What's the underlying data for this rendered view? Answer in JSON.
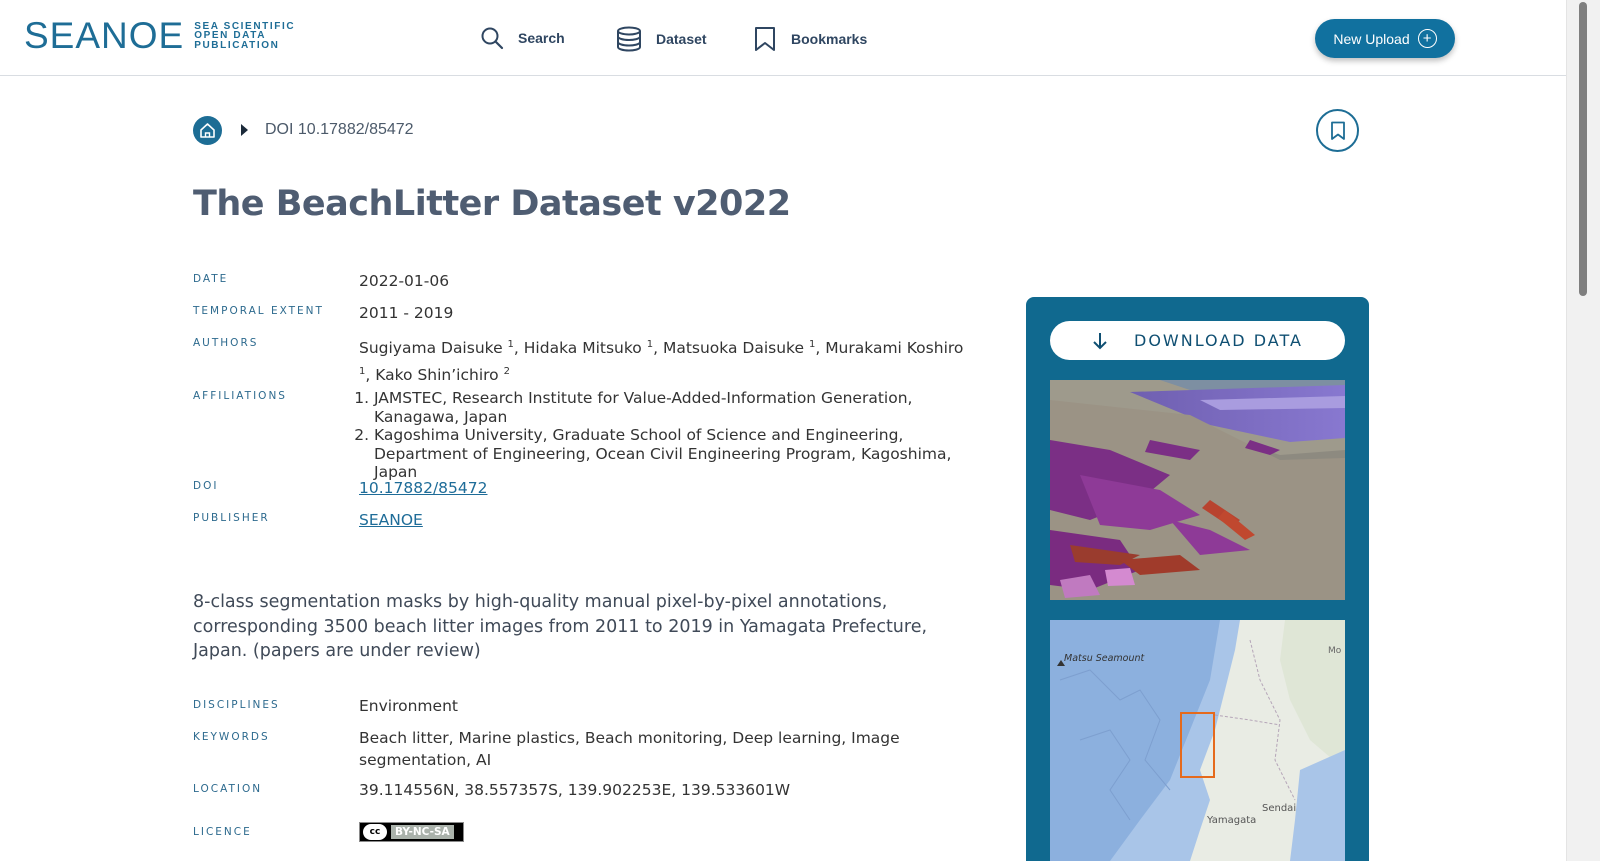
{
  "header": {
    "logo_text": "SEANOE",
    "logo_sub": [
      "SEA SCIENTIFIC",
      "OPEN DATA",
      "PUBLICATION"
    ],
    "nav": [
      {
        "label": "Search",
        "icon": "search-icon"
      },
      {
        "label": "Dataset",
        "icon": "database-icon"
      },
      {
        "label": "Bookmarks",
        "icon": "bookmark-icon"
      }
    ],
    "upload_label": "New Upload"
  },
  "breadcrumb": {
    "doi_label": "DOI 10.17882/85472"
  },
  "title": "The BeachLitter Dataset v2022",
  "meta": {
    "date": {
      "label": "DATE",
      "value": "2022-01-06"
    },
    "temporal": {
      "label": "TEMPORAL EXTENT",
      "value": "2011 - 2019"
    },
    "authors": {
      "label": "AUTHORS",
      "list": [
        {
          "name": "Sugiyama Daisuke",
          "aff": "1"
        },
        {
          "name": "Hidaka Mitsuko",
          "aff": "1"
        },
        {
          "name": "Matsuoka Daisuke",
          "aff": "1"
        },
        {
          "name": "Murakami Koshiro",
          "aff": "1"
        },
        {
          "name": "Kako Shin’ichiro",
          "aff": "2"
        }
      ]
    },
    "affiliations": {
      "label": "AFFILIATIONS",
      "list": [
        "JAMSTEC, Research Institute for Value-Added-Information Generation, Kanagawa, Japan",
        "Kagoshima University, Graduate School of Science and Engineering, Department of Engineering, Ocean Civil Engineering Program, Kagoshima, Japan"
      ]
    },
    "doi": {
      "label": "DOI",
      "value": "10.17882/85472"
    },
    "publisher": {
      "label": "PUBLISHER",
      "value": "SEANOE"
    }
  },
  "abstract": "8-class segmentation masks by high-quality manual pixel-by-pixel annotations, corresponding 3500 beach litter images from 2011 to 2019 in Yamagata Prefecture, Japan. (papers are under review)",
  "meta2": {
    "disciplines": {
      "label": "DISCIPLINES",
      "value": "Environment"
    },
    "keywords": {
      "label": "KEYWORDS",
      "value": "Beach litter, Marine plastics, Beach monitoring, Deep learning, Image segmentation, AI"
    },
    "location": {
      "label": "LOCATION",
      "value": "39.114556N, 38.557357S, 139.902253E, 139.533601W"
    },
    "licence": {
      "label": "LICENCE",
      "badge_cc": "cc",
      "badge_text": "BY-NC-SA"
    }
  },
  "side": {
    "download_label": "DOWNLOAD DATA",
    "map_labels": {
      "seamount": "Matsu Seamount",
      "sendai": "Sendai",
      "yamagata": "Yamagata",
      "edge": "Mo"
    }
  },
  "colors": {
    "brand": "#11719f",
    "panel": "#10698f",
    "title": "#4f5d72",
    "label": "#2d6a8e"
  }
}
